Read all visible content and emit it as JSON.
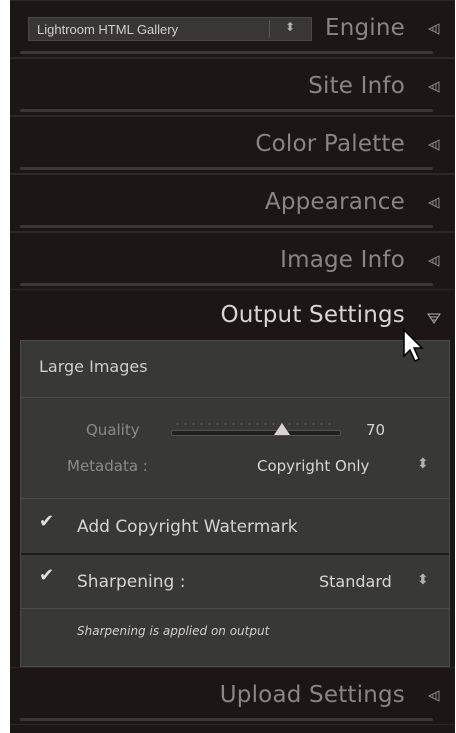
{
  "engine_dropdown": {
    "value": "Lightroom HTML Gallery"
  },
  "panels": [
    {
      "label": "Engine"
    },
    {
      "label": "Site Info"
    },
    {
      "label": "Color Palette"
    },
    {
      "label": "Appearance"
    },
    {
      "label": "Image Info"
    },
    {
      "label": "Output Settings"
    },
    {
      "label": "Upload Settings"
    }
  ],
  "output_settings": {
    "section_title": "Large Images",
    "quality_label": "Quality",
    "quality_value": "70",
    "metadata_label": "Metadata :",
    "metadata_value": "Copyright Only",
    "watermark_label": "Add Copyright Watermark",
    "watermark_checked": true,
    "sharpening_label": "Sharpening :",
    "sharpening_value": "Standard",
    "sharpening_checked": true,
    "sharpening_note": "Sharpening is applied on output"
  },
  "icons": {
    "collapsed": "triangle-left-icon",
    "expanded": "triangle-down-icon",
    "checkmark": "checkmark-icon",
    "stepper": "up-down-arrows-icon",
    "cursor": "mouse-pointer-icon"
  },
  "colors": {
    "background": "#1c1715",
    "panel_body": "#383836",
    "text_active": "#d8d5d3",
    "text_dim": "#8a8583"
  }
}
